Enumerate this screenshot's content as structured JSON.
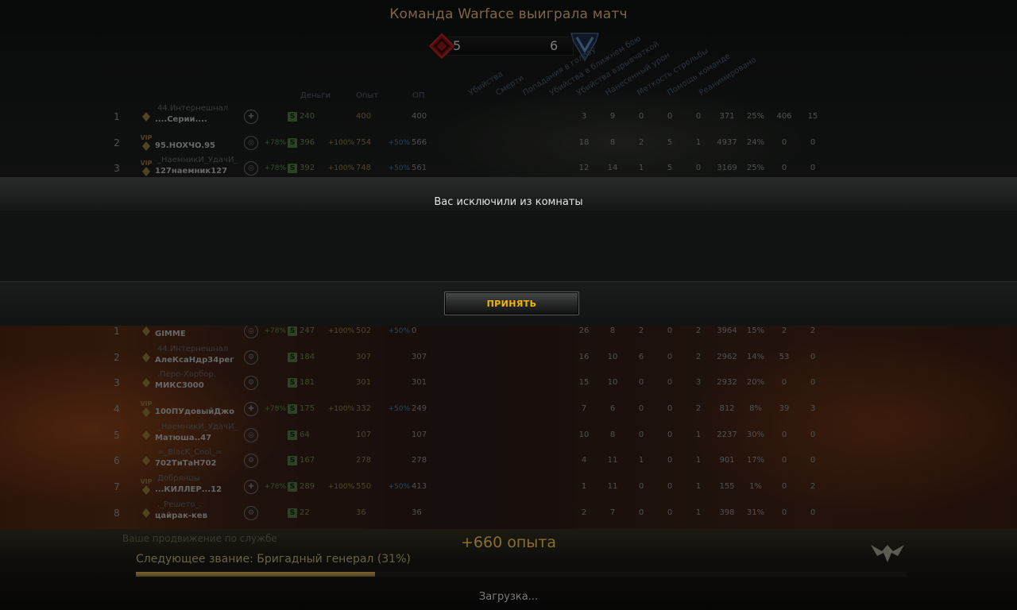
{
  "title": "Команда Warface выиграла матч",
  "score": {
    "red": "5",
    "blue": "6"
  },
  "columns": {
    "money": "Деньги",
    "exp": "Опыт",
    "op": "ОП"
  },
  "stat_columns": [
    "Убийства",
    "Смерти",
    "Попадания в голову",
    "Убийства в ближнем бою",
    "Убийства взрывчаткой",
    "Нанесенный урон",
    "Меткость стрельбы",
    "Помощь команде",
    "Реанимировано"
  ],
  "team1": [
    {
      "num": "1",
      "vip": "",
      "clan": "44.Интернешнал",
      "nick": "....Серии....",
      "cls": "medic",
      "bonus1": "",
      "money": "240",
      "bonus2": "",
      "exp": "400",
      "bonus3": "",
      "op": "400",
      "stats": [
        "3",
        "9",
        "0",
        "0",
        "0",
        "371",
        "25%",
        "406",
        "15"
      ]
    },
    {
      "num": "2",
      "vip": "VIP",
      "clan": "",
      "nick": "95.HOXЧO.95",
      "cls": "sniper",
      "bonus1": "+78%",
      "money": "396",
      "bonus2": "+100%",
      "exp": "754",
      "bonus3": "+50%",
      "op": "566",
      "stats": [
        "18",
        "8",
        "2",
        "5",
        "1",
        "4937",
        "24%",
        "0",
        "0"
      ]
    },
    {
      "num": "3",
      "vip": "VIP",
      "clan": "_НаемникИ_УдачИ_",
      "nick": "127наемник127",
      "cls": "sniper",
      "bonus1": "+78%",
      "money": "392",
      "bonus2": "+100%",
      "exp": "748",
      "bonus3": "+50%",
      "op": "561",
      "stats": [
        "12",
        "14",
        "1",
        "5",
        "0",
        "3169",
        "25%",
        "0",
        "0"
      ]
    }
  ],
  "dialog": {
    "message": "Вас исключили из комнаты",
    "accept_label": "ПРИНЯТЬ"
  },
  "team2": [
    {
      "num": "1",
      "vip": "",
      "clan": "",
      "nick": "GIMME",
      "cls": "sniper",
      "bonus1": "+78%",
      "money": "247",
      "bonus2": "+100%",
      "exp": "502",
      "bonus3": "+50%",
      "op": "0",
      "stats": [
        "26",
        "8",
        "2",
        "0",
        "2",
        "3964",
        "15%",
        "2",
        "2"
      ]
    },
    {
      "num": "2",
      "vip": "",
      "clan": "44.Интернешнал",
      "nick": "АлеКсаНдр34рег",
      "cls": "engineer",
      "bonus1": "",
      "money": "184",
      "bonus2": "",
      "exp": "307",
      "bonus3": "",
      "op": "307",
      "stats": [
        "16",
        "10",
        "6",
        "0",
        "2",
        "2962",
        "14%",
        "53",
        "0"
      ]
    },
    {
      "num": "3",
      "vip": "",
      "clan": ".Перо-Харбор.",
      "nick": "МИКС3000",
      "cls": "engineer",
      "bonus1": "",
      "money": "181",
      "bonus2": "",
      "exp": "301",
      "bonus3": "",
      "op": "301",
      "stats": [
        "15",
        "10",
        "0",
        "0",
        "3",
        "2932",
        "20%",
        "0",
        "0"
      ]
    },
    {
      "num": "4",
      "vip": "VIP",
      "clan": "",
      "nick": "100ПУдовыйДжо",
      "cls": "medic",
      "bonus1": "+78%",
      "money": "175",
      "bonus2": "+100%",
      "exp": "332",
      "bonus3": "+50%",
      "op": "249",
      "stats": [
        "7",
        "6",
        "0",
        "0",
        "2",
        "812",
        "8%",
        "39",
        "3"
      ]
    },
    {
      "num": "5",
      "vip": "",
      "clan": "_НаемникИ_УдачИ_",
      "nick": "Матюша..47",
      "cls": "sniper",
      "bonus1": "",
      "money": "64",
      "bonus2": "",
      "exp": "107",
      "bonus3": "",
      "op": "107",
      "stats": [
        "10",
        "8",
        "0",
        "0",
        "1",
        "2237",
        "30%",
        "0",
        "0"
      ]
    },
    {
      "num": "6",
      "vip": "",
      "clan": "=_BlacK_Cool_=",
      "nick": "702ТиТаН702",
      "cls": "engineer",
      "bonus1": "",
      "money": "167",
      "bonus2": "",
      "exp": "278",
      "bonus3": "",
      "op": "278",
      "stats": [
        "4",
        "11",
        "1",
        "0",
        "1",
        "901",
        "17%",
        "0",
        "0"
      ]
    },
    {
      "num": "7",
      "vip": "VIP",
      "clan": "Добрянцы",
      "nick": "...КИЛЛЕР...12",
      "cls": "medic",
      "bonus1": "+78%",
      "money": "289",
      "bonus2": "+100%",
      "exp": "550",
      "bonus3": "+50%",
      "op": "413",
      "stats": [
        "1",
        "11",
        "0",
        "0",
        "1",
        "155",
        "1%",
        "0",
        "2"
      ]
    },
    {
      "num": "8",
      "vip": "",
      "clan": "._Решето_.",
      "nick": "цайрак-кев",
      "cls": "engineer",
      "bonus1": "",
      "money": "22",
      "bonus2": "",
      "exp": "36",
      "bonus3": "",
      "op": "36",
      "stats": [
        "2",
        "7",
        "0",
        "0",
        "1",
        "398",
        "31%",
        "0",
        "0"
      ]
    }
  ],
  "footer": {
    "promotion_label": "Ваше продвижение по службе",
    "xp_gain": "+660 опыта",
    "next_rank": "Следующее звание: Бригадный генерал (31%)",
    "rank_progress": 0.31,
    "loading": "Загрузка..."
  }
}
